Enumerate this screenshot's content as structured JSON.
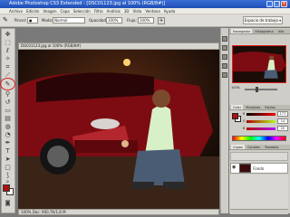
{
  "window": {
    "title": "Adobe Photoshop CS3 Extended - [DSC01123.jpg al 100% (RGB/8#)]",
    "ps_badge": "Ps"
  },
  "menu": [
    "Archivo",
    "Edición",
    "Imagen",
    "Capa",
    "Selección",
    "Filtro",
    "Análisis",
    "3D",
    "Vista",
    "Ventana",
    "Ayuda"
  ],
  "options": {
    "size_label": "Pincel:",
    "mode_label": "Modo:",
    "mode_value": "Normal",
    "opacity_label": "Opacidad:",
    "opacity_value": "100%",
    "flow_label": "Flujo:",
    "flow_value": "100%",
    "workspace_label": "Espacio de trabajo ▾"
  },
  "document": {
    "title": "DSC01123.jpg al 100% (RGB/8#)",
    "status": "100%   Doc: 900,7K/1,8 M"
  },
  "panels": {
    "navigator_tabs": [
      "Navegador",
      "Histograma",
      "Info"
    ],
    "zoom_value": "100%",
    "color_tabs": [
      "Color",
      "Muestras",
      "Estilos"
    ],
    "layers_tabs": [
      "Capas",
      "Canales",
      "Trazados"
    ],
    "layer_name": "Fondo",
    "channels": [
      {
        "label": "R",
        "value": "177"
      },
      {
        "label": "G",
        "value": "14"
      },
      {
        "label": "B",
        "value": "20"
      }
    ]
  },
  "colors": {
    "foreground": "#b10e14",
    "background": "#ffffff",
    "title_bar": "#2a5bc4"
  },
  "icons": {
    "tools": [
      "move-icon",
      "marquee-icon",
      "lasso-icon",
      "magic-wand-icon",
      "crop-icon",
      "slice-icon",
      "healing-brush-icon",
      "brush-icon",
      "clone-stamp-icon",
      "history-brush-icon",
      "eraser-icon",
      "gradient-icon",
      "blur-icon",
      "dodge-icon",
      "pen-icon",
      "type-icon",
      "path-select-icon",
      "shape-icon",
      "notes-icon",
      "eyedropper-icon",
      "hand-icon",
      "zoom-icon"
    ]
  }
}
